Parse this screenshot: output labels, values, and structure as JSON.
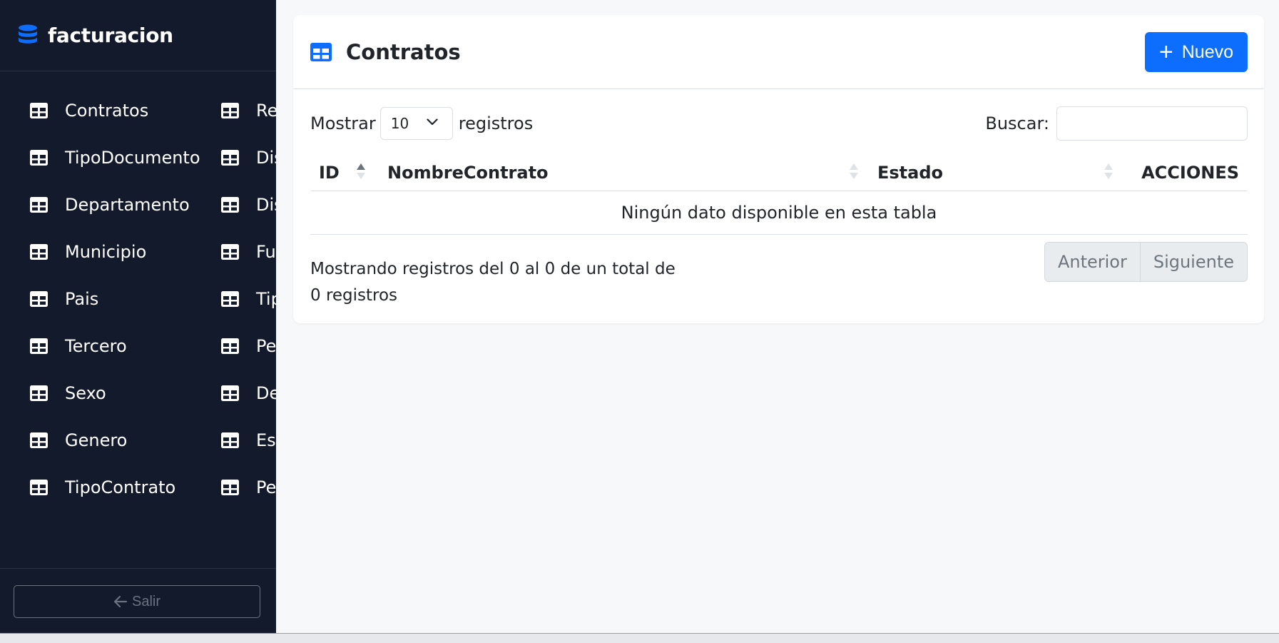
{
  "sidebar": {
    "brand": "facturacion",
    "col1": [
      {
        "label": "Contratos"
      },
      {
        "label": "TipoDocumento"
      },
      {
        "label": "Departamento"
      },
      {
        "label": "Municipio"
      },
      {
        "label": "Pais"
      },
      {
        "label": "Tercero"
      },
      {
        "label": "Sexo"
      },
      {
        "label": "Genero"
      },
      {
        "label": "TipoContrato"
      }
    ],
    "col2": [
      {
        "label": "Reg"
      },
      {
        "label": "Dis"
      },
      {
        "label": "Dis"
      },
      {
        "label": "Fun"
      },
      {
        "label": "Tip"
      },
      {
        "label": "Per"
      },
      {
        "label": "De"
      },
      {
        "label": "Esp"
      },
      {
        "label": "Per"
      }
    ],
    "logout_label": "Salir"
  },
  "card": {
    "title": "Contratos",
    "new_button": "Nuevo"
  },
  "controls": {
    "show_label": "Mostrar",
    "page_size": "10",
    "records_label": "registros",
    "search_label": "Buscar:",
    "search_value": ""
  },
  "table": {
    "columns": [
      "ID",
      "NombreContrato",
      "Estado",
      "ACCIONES"
    ],
    "empty_message": "Ningún dato disponible en esta tabla"
  },
  "footer": {
    "info": "Mostrando registros del 0 al 0 de un total de 0 registros",
    "prev": "Anterior",
    "next": "Siguiente"
  },
  "colors": {
    "sidebar_bg": "#121a2b",
    "accent": "#0d6efd"
  }
}
